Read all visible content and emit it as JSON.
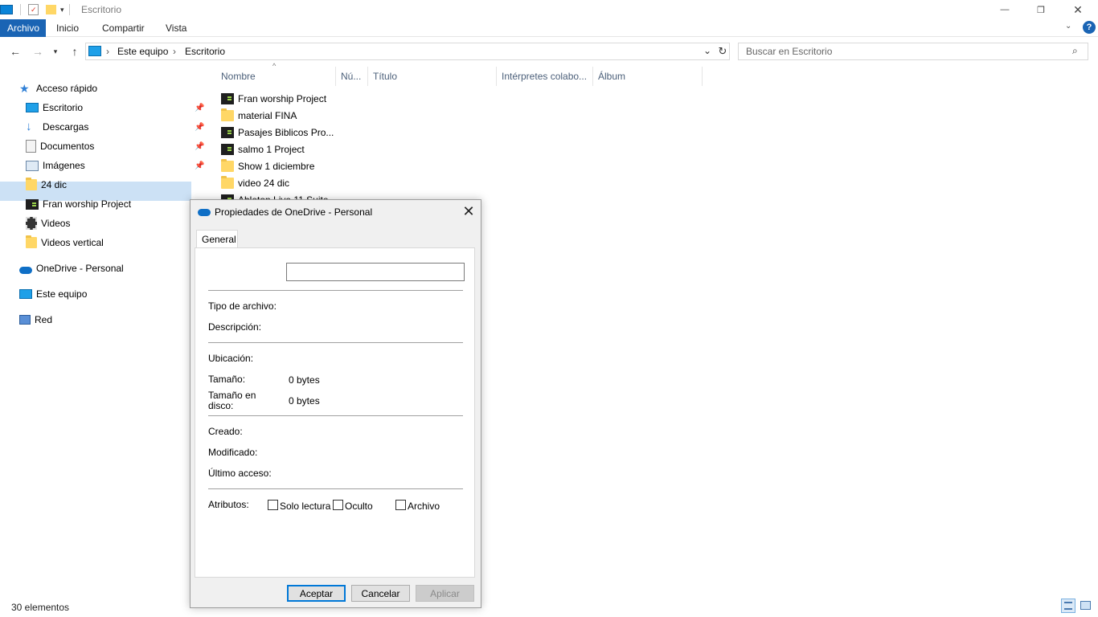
{
  "window": {
    "title": "Escritorio",
    "minimize_glyph": "—",
    "maximize_glyph": "❐",
    "close_glyph": "✕"
  },
  "ribbon": {
    "tabs": [
      "Archivo",
      "Inicio",
      "Compartir",
      "Vista"
    ],
    "active_tab": "Archivo",
    "active_color": "#1a64b4"
  },
  "address": {
    "path": [
      "Este equipo",
      "Escritorio"
    ],
    "search_placeholder": "Buscar en Escritorio"
  },
  "nav_pane": {
    "items": [
      {
        "label": "Acceso rápido",
        "icon": "star-icon",
        "pinned": false
      },
      {
        "label": "Escritorio",
        "icon": "desktop-icon",
        "pinned": true
      },
      {
        "label": "Descargas",
        "icon": "download-icon",
        "pinned": true
      },
      {
        "label": "Documentos",
        "icon": "documents-icon",
        "pinned": true
      },
      {
        "label": "Imágenes",
        "icon": "images-icon",
        "pinned": true
      },
      {
        "label": "24 dic",
        "icon": "folder-icon",
        "pinned": false
      },
      {
        "label": "Fran worship Project",
        "icon": "project-icon",
        "pinned": false
      },
      {
        "label": "Videos",
        "icon": "video-icon",
        "pinned": false
      },
      {
        "label": "Videos vertical",
        "icon": "folder-icon",
        "pinned": false
      },
      {
        "label": "OneDrive - Personal",
        "icon": "onedrive-icon",
        "pinned": false,
        "selected": true
      },
      {
        "label": "Este equipo",
        "icon": "computer-icon",
        "pinned": false
      },
      {
        "label": "Red",
        "icon": "network-icon",
        "pinned": false
      }
    ]
  },
  "file_list": {
    "columns": [
      "Nombre",
      "Nú...",
      "Título",
      "Intérpretes colabo...",
      "Álbum"
    ],
    "rows": [
      {
        "name": "Fran worship Project",
        "type": "project"
      },
      {
        "name": "material FINA",
        "type": "folder"
      },
      {
        "name": "Pasajes Biblicos Pro...",
        "type": "project"
      },
      {
        "name": "salmo 1 Project",
        "type": "project"
      },
      {
        "name": "Show 1 diciembre",
        "type": "folder"
      },
      {
        "name": "video 24 dic",
        "type": "folder"
      },
      {
        "name": "Ableton Live 11 Suite",
        "type": "project"
      }
    ]
  },
  "status_bar": {
    "item_count": "30 elementos"
  },
  "dialog": {
    "title": "Propiedades de OneDrive - Personal",
    "tab": "General",
    "name_value": "",
    "labels": {
      "file_type": "Tipo de archivo:",
      "description": "Descripción:",
      "location": "Ubicación:",
      "size": "Tamaño:",
      "size_on_disk": "Tamaño en disco:",
      "created": "Creado:",
      "modified": "Modificado:",
      "accessed": "Último acceso:",
      "attributes": "Atributos:"
    },
    "values": {
      "size": "0 bytes",
      "size_on_disk": "0 bytes"
    },
    "attributes": [
      {
        "label": "Solo lectura",
        "checked": false
      },
      {
        "label": "Oculto",
        "checked": false
      },
      {
        "label": "Archivo",
        "checked": false
      }
    ],
    "buttons": {
      "ok": "Aceptar",
      "cancel": "Cancelar",
      "apply": "Aplicar"
    }
  }
}
